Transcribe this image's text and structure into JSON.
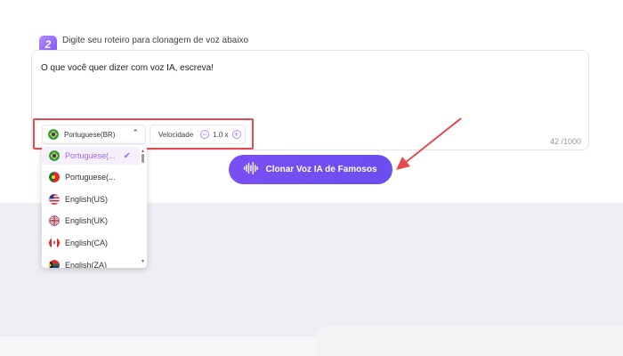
{
  "step": {
    "number": "2",
    "title": "Digite seu roteiro para clonagem de voz abaixo"
  },
  "script": {
    "text": "O que você quer dizer com voz IA, escreva!",
    "char_count": "42 /1000"
  },
  "language_select": {
    "selected": "Portuguese(BR)",
    "selected_flag": "brazil-flag"
  },
  "speed": {
    "label": "Velocidade",
    "value": "1.0 x",
    "minus": "−",
    "plus": "+"
  },
  "dropdown": {
    "items": [
      {
        "label": "Portuguese(...",
        "flag": "brazil-flag",
        "selected": true
      },
      {
        "label": "Portuguese(...",
        "flag": "portugal-flag",
        "selected": false
      },
      {
        "label": "English(US)",
        "flag": "usa-flag",
        "selected": false
      },
      {
        "label": "English(UK)",
        "flag": "uk-flag",
        "selected": false
      },
      {
        "label": "English(CA)",
        "flag": "canada-flag",
        "selected": false
      },
      {
        "label": "English(ZA)",
        "flag": "south-africa-flag",
        "selected": false
      }
    ],
    "check_icon": "check-icon"
  },
  "clone_button": {
    "label": "Clonar Voz IA de Famosos",
    "icon": "waveform-icon"
  },
  "colors": {
    "accent": "#7a4ff3",
    "highlight": "#e5484d",
    "background_band": "#eeeff4"
  }
}
